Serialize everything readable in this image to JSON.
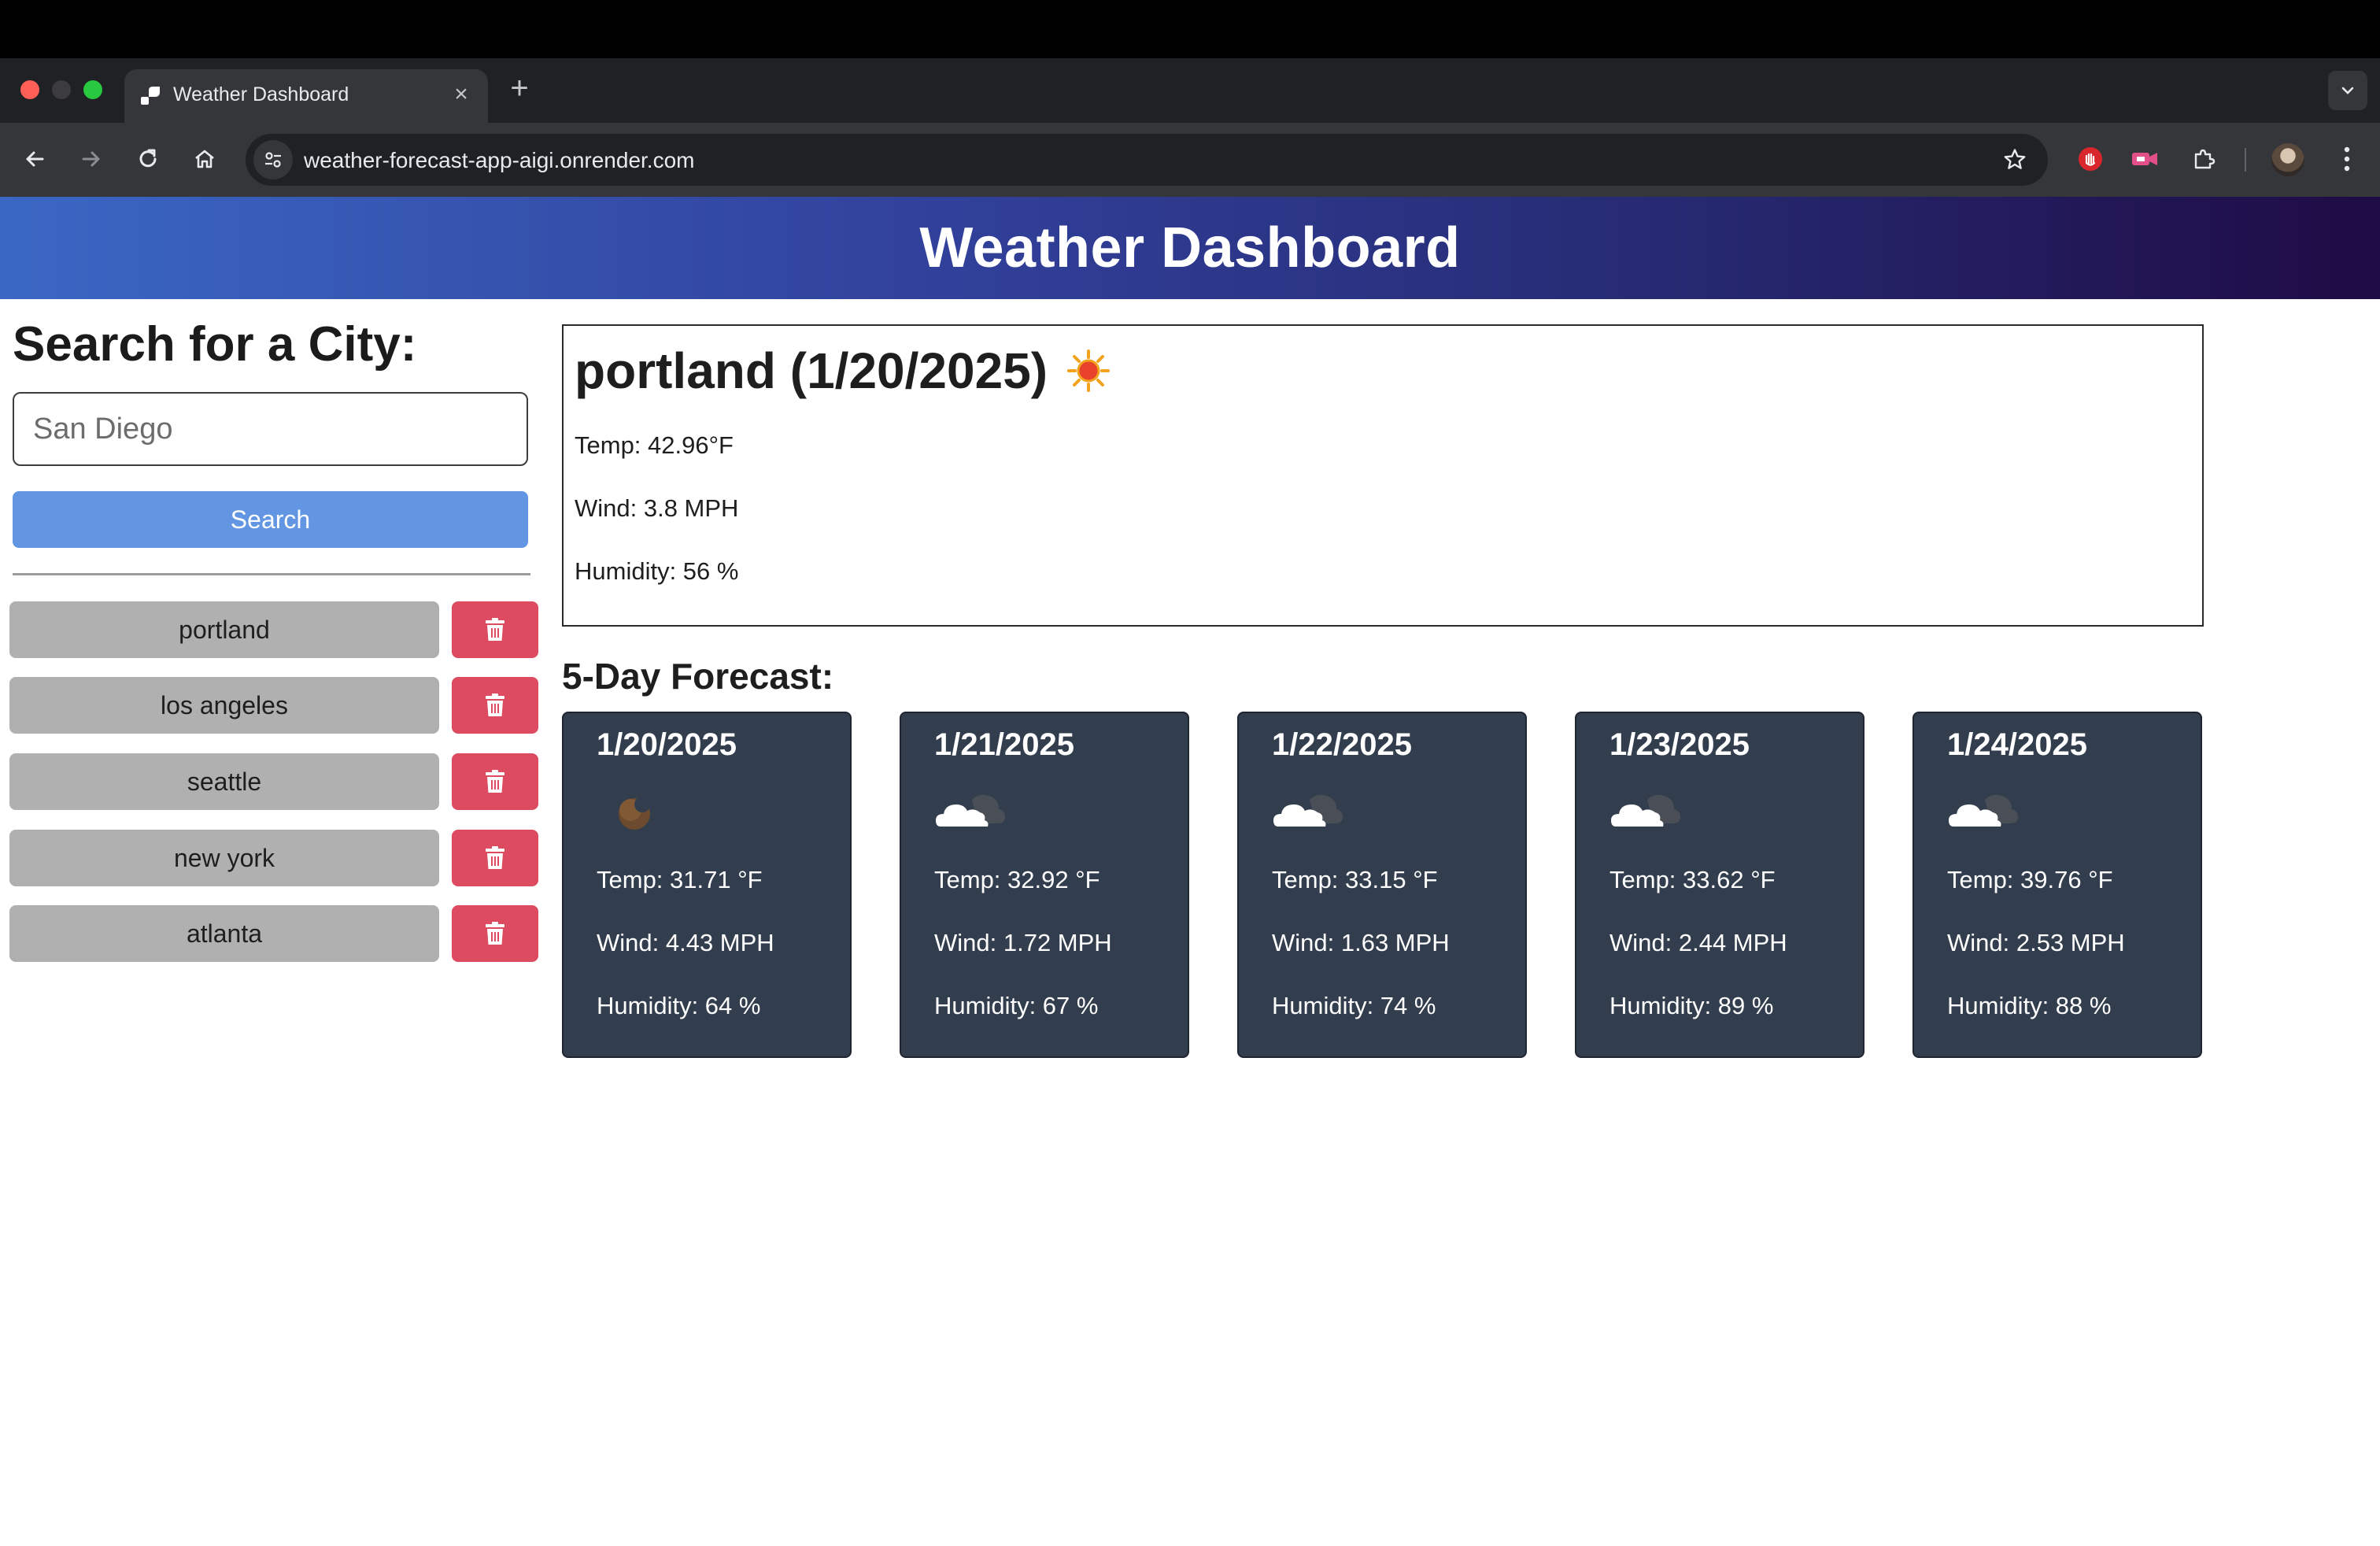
{
  "browser": {
    "tab_title": "Weather Dashboard",
    "tab_close": "×",
    "new_tab": "+",
    "url": "weather-forecast-app-aigi.onrender.com"
  },
  "header": {
    "title": "Weather Dashboard"
  },
  "sidebar": {
    "search_title": "Search for a City:",
    "search_placeholder": "San Diego",
    "search_value": "",
    "search_button": "Search",
    "history": [
      {
        "city": "portland"
      },
      {
        "city": "los angeles"
      },
      {
        "city": "seattle"
      },
      {
        "city": "new york"
      },
      {
        "city": "atlanta"
      }
    ]
  },
  "current": {
    "heading": "portland (1/20/2025)",
    "icon": "sun-icon",
    "temp": "Temp: 42.96°F",
    "wind": "Wind: 3.8 MPH",
    "humidity": "Humidity: 56 %"
  },
  "forecast": {
    "title": "5-Day Forecast:",
    "days": [
      {
        "date": "1/20/2025",
        "icon": "moon-icon",
        "temp": "Temp: 31.71 °F",
        "wind": "Wind: 4.43 MPH",
        "humidity": "Humidity: 64 %"
      },
      {
        "date": "1/21/2025",
        "icon": "cloud-night-icon",
        "temp": "Temp: 32.92 °F",
        "wind": "Wind: 1.72 MPH",
        "humidity": "Humidity: 67 %"
      },
      {
        "date": "1/22/2025",
        "icon": "cloud-night-icon",
        "temp": "Temp: 33.15 °F",
        "wind": "Wind: 1.63 MPH",
        "humidity": "Humidity: 74 %"
      },
      {
        "date": "1/23/2025",
        "icon": "cloud-night-icon",
        "temp": "Temp: 33.62 °F",
        "wind": "Wind: 2.44 MPH",
        "humidity": "Humidity: 89 %"
      },
      {
        "date": "1/24/2025",
        "icon": "cloud-night-icon",
        "temp": "Temp: 39.76 °F",
        "wind": "Wind: 2.53 MPH",
        "humidity": "Humidity: 88 %"
      }
    ]
  },
  "colors": {
    "header_gradient_start": "#3a67c4",
    "header_gradient_end": "#1f0b45",
    "search_button": "#6295e2",
    "history_button": "#b0b0b0",
    "delete_button": "#dc4b5f",
    "forecast_card": "#323d4d"
  }
}
